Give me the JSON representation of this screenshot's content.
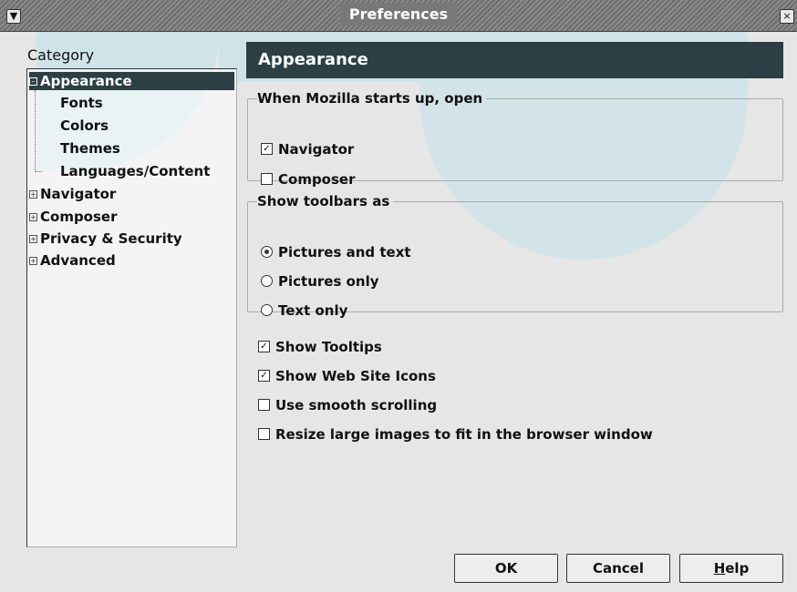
{
  "window": {
    "title": "Preferences",
    "menu_icon": "chevron-down-icon",
    "close_icon": "close-icon"
  },
  "category": {
    "label": "Category",
    "items": [
      {
        "label": "Appearance",
        "level": 0,
        "expanded": true,
        "selected": true
      },
      {
        "label": "Fonts",
        "level": 1
      },
      {
        "label": "Colors",
        "level": 1
      },
      {
        "label": "Themes",
        "level": 1
      },
      {
        "label": "Languages/Content",
        "level": 1
      },
      {
        "label": "Navigator",
        "level": 0,
        "expanded": false
      },
      {
        "label": "Composer",
        "level": 0,
        "expanded": false
      },
      {
        "label": "Privacy & Security",
        "level": 0,
        "expanded": false
      },
      {
        "label": "Advanced",
        "level": 0,
        "expanded": false
      }
    ]
  },
  "panel": {
    "header": "Appearance",
    "startup": {
      "legend": "When Mozilla starts up, open",
      "options": [
        {
          "label": "Navigator",
          "checked": true
        },
        {
          "label": "Composer",
          "checked": false
        }
      ]
    },
    "toolbars": {
      "legend": "Show toolbars as",
      "options": [
        {
          "label": "Pictures and text",
          "selected": true
        },
        {
          "label": "Pictures only",
          "selected": false
        },
        {
          "label": "Text only",
          "selected": false
        }
      ]
    },
    "misc": [
      {
        "label": "Show Tooltips",
        "checked": true
      },
      {
        "label": "Show Web Site Icons",
        "checked": true
      },
      {
        "label": "Use smooth scrolling",
        "checked": false
      },
      {
        "label": "Resize large images to fit in the browser window",
        "checked": false
      }
    ]
  },
  "buttons": {
    "ok": "OK",
    "cancel": "Cancel",
    "help_mnemonic": "H",
    "help_rest": "elp"
  },
  "colors": {
    "header_bg": "#2b3f45",
    "selection_bg": "#2b3f45",
    "window_bg": "#e6e6e6",
    "watermark": "#c4e3ea"
  }
}
